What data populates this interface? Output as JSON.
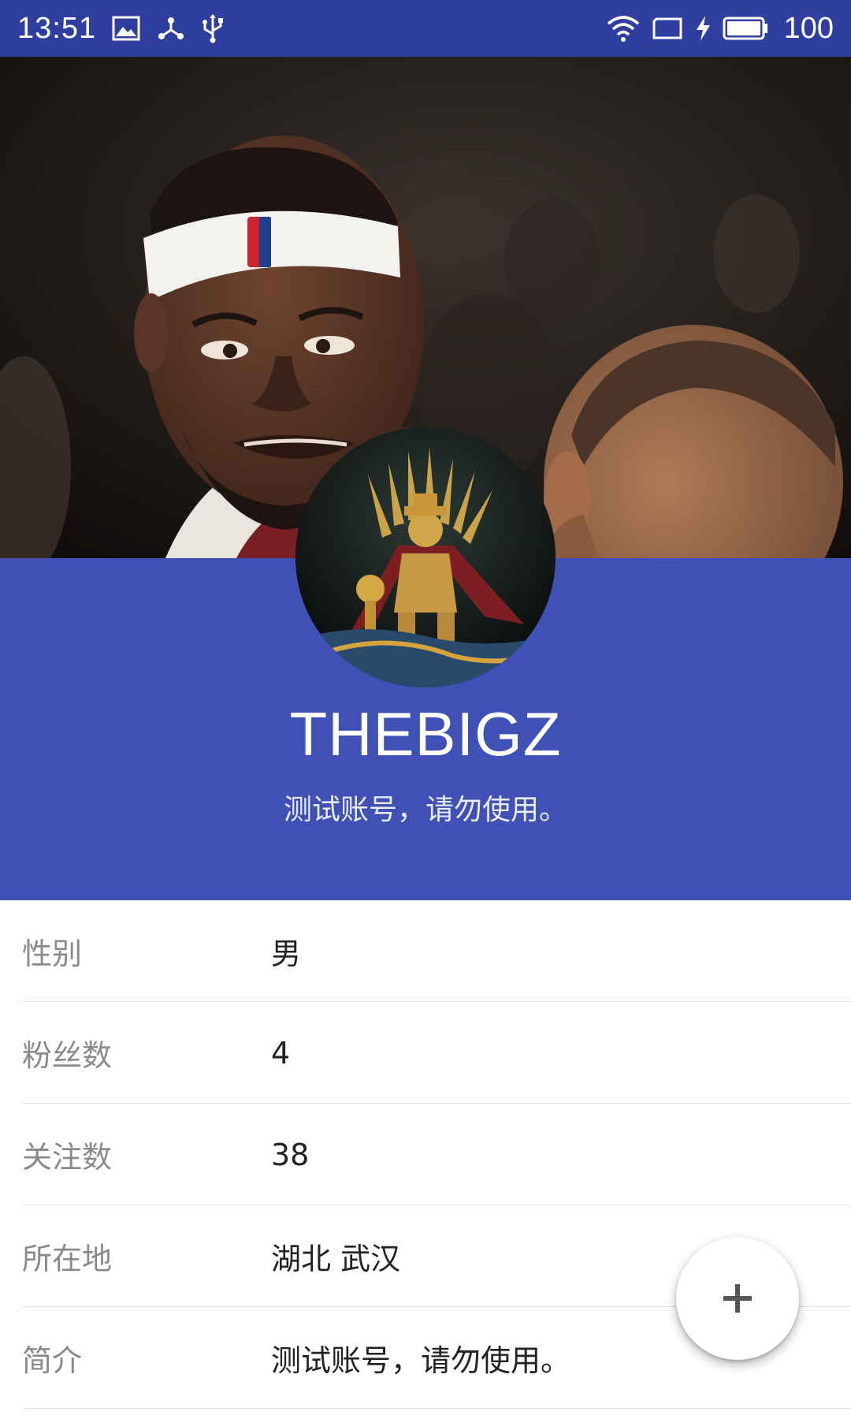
{
  "status_bar": {
    "time": "13:51",
    "battery_level": "100",
    "icons": [
      "image-icon",
      "share-network-icon",
      "usb-icon",
      "wifi-icon",
      "screen-rotate-icon",
      "charging-icon",
      "battery-icon"
    ]
  },
  "header": {
    "photo": "cover-photo",
    "background_color": "#3F51B5",
    "status_color": "#303F9F"
  },
  "profile": {
    "username": "THEBIGZ",
    "bio": "测试账号，请勿使用。"
  },
  "info": {
    "rows": [
      {
        "label": "性别",
        "value": "男"
      },
      {
        "label": "粉丝数",
        "value": "4"
      },
      {
        "label": "关注数",
        "value": "38"
      },
      {
        "label": "所在地",
        "value": "湖北 武汉"
      },
      {
        "label": "简介",
        "value": "测试账号，请勿使用。"
      }
    ]
  },
  "fab": {
    "icon": "plus-icon"
  }
}
